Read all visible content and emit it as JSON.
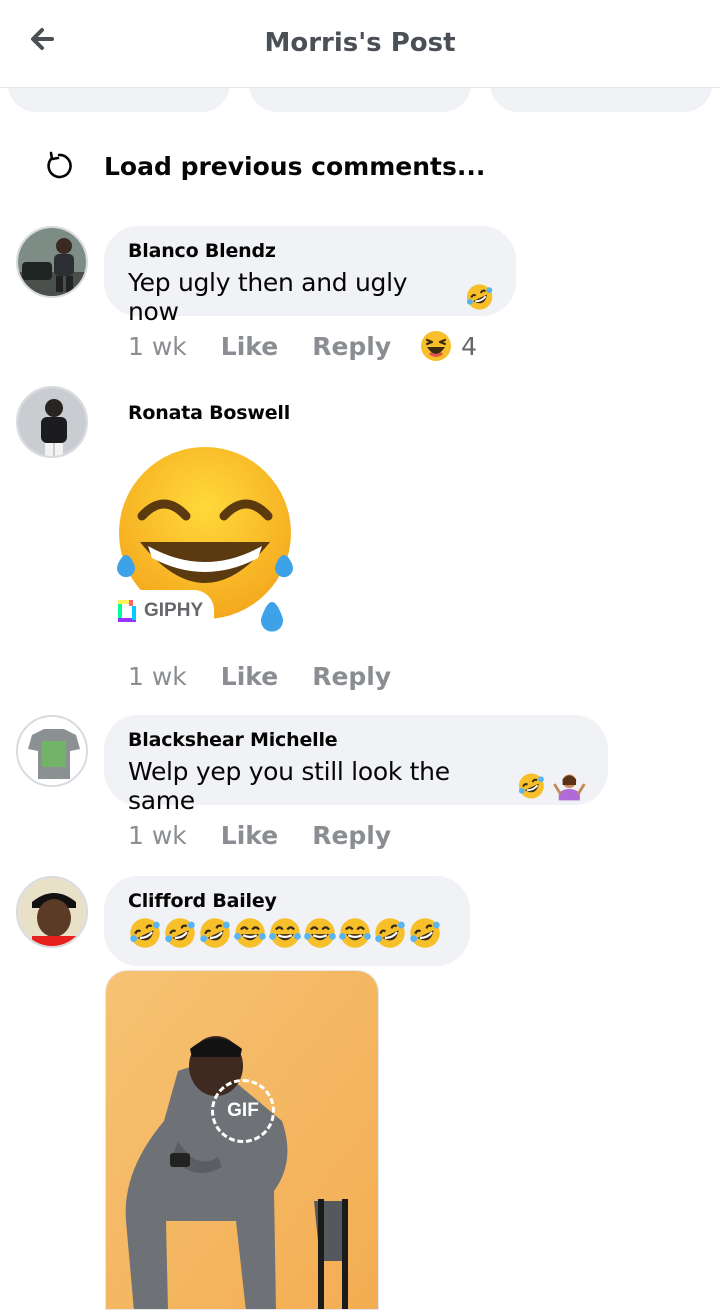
{
  "header": {
    "title": "Morris's Post",
    "back_icon": "arrow-left-icon"
  },
  "load_previous": {
    "label": "Load previous comments...",
    "icon": "refresh-icon"
  },
  "comments": [
    {
      "author": "Blanco Blendz",
      "text": "Yep ugly then and ugly now",
      "text_emojis": [
        "rolling-on-floor-laughing"
      ],
      "time": "1 wk",
      "like": "Like",
      "reply": "Reply",
      "reaction": "haha",
      "reaction_count": "4"
    },
    {
      "author": "Ronata Boswell",
      "sticker": "face-with-tears-of-joy",
      "sticker_source": "GIPHY",
      "time": "1 wk",
      "like": "Like",
      "reply": "Reply"
    },
    {
      "author": "Blackshear Michelle",
      "text": "Welp yep you still look the same",
      "text_emojis": [
        "rolling-on-floor-laughing",
        "person-shrugging"
      ],
      "time": "1 wk",
      "like": "Like",
      "reply": "Reply"
    },
    {
      "author": "Clifford Bailey",
      "text_emojis": [
        "rofl",
        "rofl",
        "rofl",
        "joy",
        "joy",
        "joy",
        "joy",
        "rofl",
        "rofl"
      ],
      "gif_label": "GIF"
    }
  ],
  "colors": {
    "bubble": "#f0f2f5",
    "meta": "#8a8d91",
    "gif_bg": "#f4b864"
  }
}
